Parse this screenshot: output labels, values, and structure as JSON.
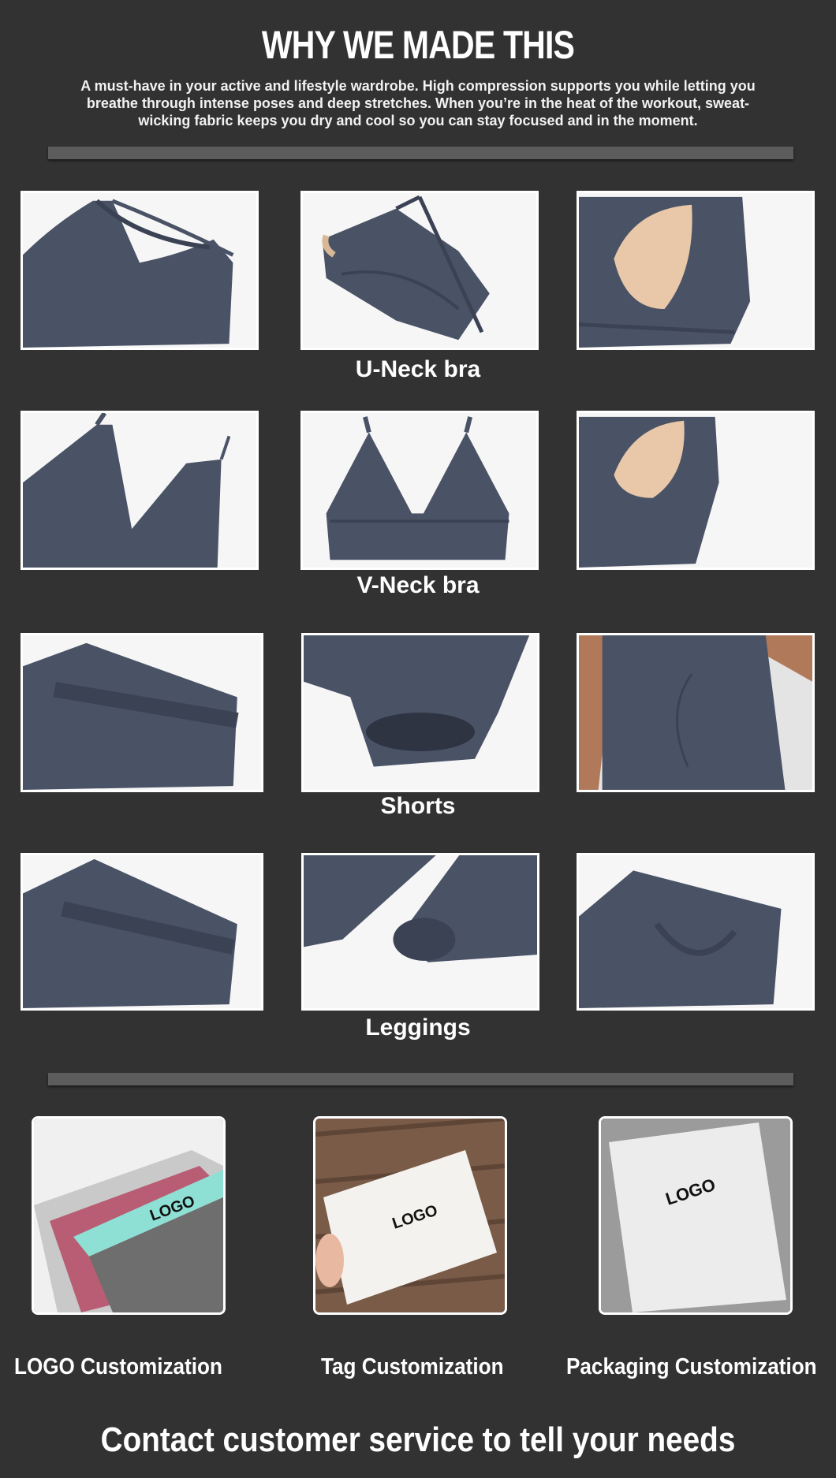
{
  "headline": "WHY WE MADE THIS",
  "intro": "A must-have in your active and lifestyle wardrobe. High compression supports you while letting you breathe through intense poses and deep stretches.  When you’re in the heat of the workout, sweat-wicking fabric keeps you dry and cool so you can stay focused and in the moment.",
  "sections": [
    {
      "caption": "U-Neck bra"
    },
    {
      "caption": "V-Neck bra"
    },
    {
      "caption": "Shorts"
    },
    {
      "caption": "Leggings"
    }
  ],
  "customization": [
    {
      "label": "LOGO Customization",
      "mark": "LOGO"
    },
    {
      "label": "Tag Customization",
      "mark": "LOGO"
    },
    {
      "label": "Packaging Customization",
      "mark": "LOGO"
    }
  ],
  "footer": "Contact customer service to tell your needs",
  "colors": {
    "background": "#323232",
    "divider": "#5c5c5c",
    "fabric": "#4a5366",
    "fabric_dark": "#3a4254",
    "pad": "#e8c8a8"
  }
}
